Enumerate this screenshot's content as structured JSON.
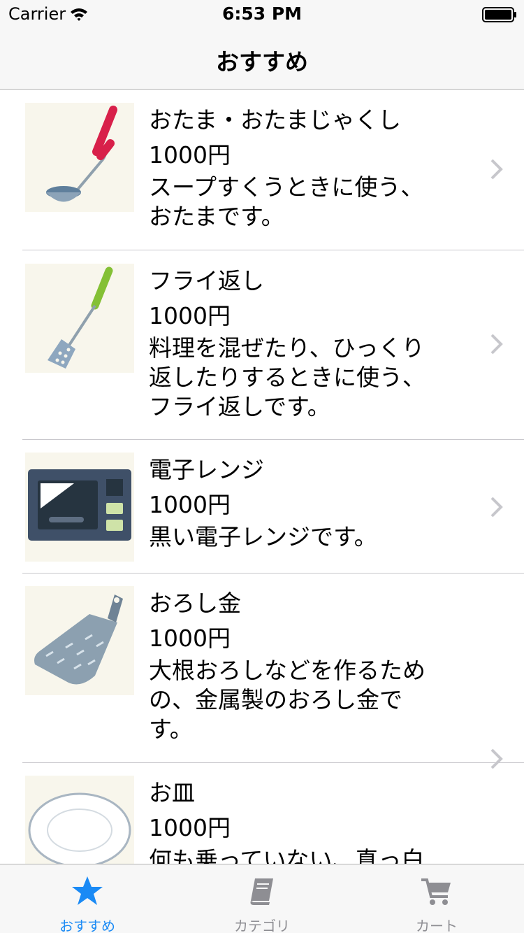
{
  "status": {
    "carrier": "Carrier",
    "time": "6:53 PM"
  },
  "nav": {
    "title": "おすすめ"
  },
  "items": [
    {
      "name": "おたま・おたまじゃくし",
      "price": "1000円",
      "desc": "スープすくうときに使う、\nおたまです。",
      "icon": "ladle-icon"
    },
    {
      "name": "フライ返し",
      "price": "1000円",
      "desc": "料理を混ぜたり、ひっくり\n返したりするときに使う、\nフライ返しです。",
      "icon": "spatula-icon"
    },
    {
      "name": "電子レンジ",
      "price": "1000円",
      "desc": "黒い電子レンジです。",
      "icon": "microwave-icon"
    },
    {
      "name": "おろし金",
      "price": "1000円",
      "desc": "大根おろしなどを作るため\nの、金属製のおろし金で\nす。",
      "icon": "grater-icon"
    },
    {
      "name": "お皿",
      "price": "1000円",
      "desc": "何も乗っていない、真っ白",
      "icon": "plate-icon"
    }
  ],
  "tabs": [
    {
      "label": "おすすめ",
      "icon": "star-icon",
      "selected": true
    },
    {
      "label": "カテゴリ",
      "icon": "book-icon",
      "selected": false
    },
    {
      "label": "カート",
      "icon": "cart-icon",
      "selected": false
    }
  ],
  "colors": {
    "accent": "#1a8af5",
    "inactive": "#8e8e93",
    "bar_background": "#f7f7f7"
  }
}
